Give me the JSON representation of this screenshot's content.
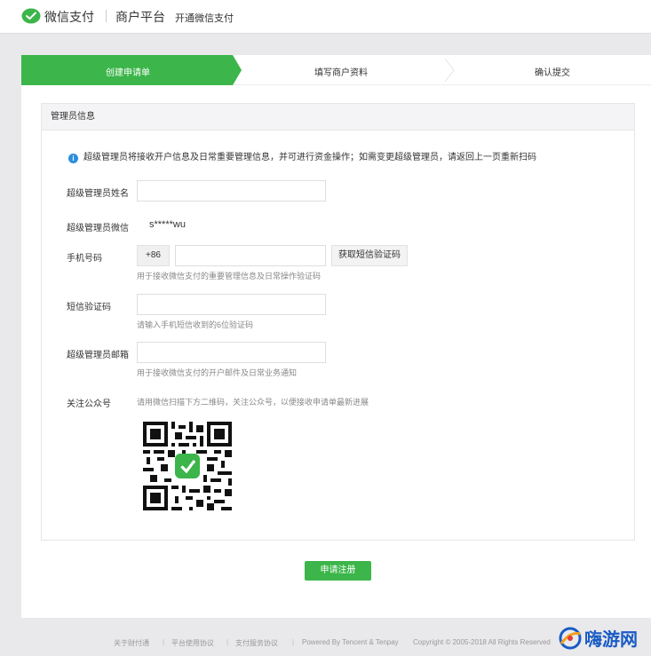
{
  "header": {
    "brand": "微信支付",
    "platform": "商户平台",
    "open_link": "开通微信支付"
  },
  "steps": [
    {
      "label": "创建申请单",
      "active": true
    },
    {
      "label": "填写商户资料",
      "active": false
    },
    {
      "label": "确认提交",
      "active": false
    }
  ],
  "panel": {
    "title": "管理员信息",
    "notice": "超级管理员将接收开户信息及日常重要管理信息，并可进行资金操作；如需变更超级管理员，请返回上一页重新扫码"
  },
  "form": {
    "admin_name_label": "超级管理员姓名",
    "admin_name_value": "",
    "admin_wechat_label": "超级管理员微信",
    "admin_wechat_value": "s*****wu",
    "phone_label": "手机号码",
    "phone_prefix": "+86",
    "phone_value": "",
    "sms_button": "获取短信验证码",
    "phone_hint": "用于接收微信支付的重要管理信息及日常操作验证码",
    "sms_code_label": "短信验证码",
    "sms_code_value": "",
    "sms_code_hint": "请输入手机短信收到的6位验证码",
    "email_label": "超级管理员邮箱",
    "email_value": "",
    "email_hint": "用于接收微信支付的开户邮件及日常业务通知",
    "follow_label": "关注公众号",
    "follow_hint": "请用微信扫描下方二维码，关注公众号，以便接收申请单最新进展"
  },
  "submit_label": "申请注册",
  "footer": {
    "about": "关于财付通",
    "platform_agreement": "平台使用协议",
    "payment_agreement": "支付服务协议",
    "powered": "Powered By Tencent & Tenpay",
    "copyright": "Copyright © 2005-2018 All Rights Reserved"
  },
  "watermark": "嗨游网",
  "colors": {
    "accent": "#3cb54a",
    "info": "#2b8ee0",
    "watermark": "#1a5bc4"
  }
}
